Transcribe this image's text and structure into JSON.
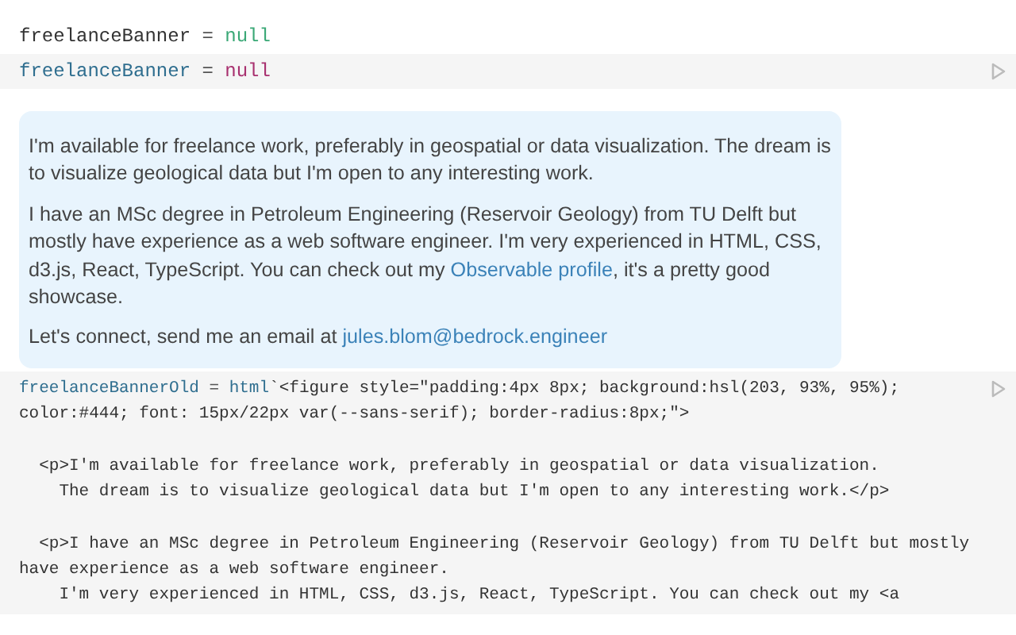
{
  "cells": [
    {
      "kind": "output",
      "tokens": [
        {
          "text": "freelanceBanner",
          "kind": "plain"
        },
        {
          "text": " = ",
          "kind": "op"
        },
        {
          "text": "null",
          "kind": "literal"
        }
      ]
    },
    {
      "kind": "code",
      "lines": [
        {
          "tokens": [
            {
              "text": "freelanceBanner",
              "kind": "variable"
            },
            {
              "text": " = ",
              "kind": "op"
            },
            {
              "text": "null",
              "kind": "null"
            }
          ]
        }
      ]
    },
    {
      "kind": "banner",
      "paragraphs": [
        [
          {
            "text": "I'm available for freelance work, preferably in geospatial or data visualization. The dream is to visualize geological data but I'm open to any interesting work.",
            "kind": "text"
          }
        ],
        [
          {
            "text": "I have an MSc degree in Petroleum Engineering (Reservoir Geology) from TU Delft but mostly have experience as a web software engineer. I'm very experienced in HTML, CSS, d3.js, React, TypeScript. You can check out my ",
            "kind": "text"
          },
          {
            "text": "Observable profile",
            "kind": "link"
          },
          {
            "text": ", it's a pretty good showcase.",
            "kind": "text"
          }
        ],
        [
          {
            "text": "Let's connect, send me an email at ",
            "kind": "text"
          },
          {
            "text": "jules.blom@bedrock.engineer",
            "kind": "link"
          }
        ]
      ]
    },
    {
      "kind": "code",
      "lines": [
        {
          "tokens": [
            {
              "text": "freelanceBannerOld",
              "kind": "variable"
            },
            {
              "text": " = ",
              "kind": "op"
            },
            {
              "text": "html",
              "kind": "keyword"
            },
            {
              "text": "`<figure style=\"padding:4px 8px; background:hsl(203, 93%, 95%);",
              "kind": "string"
            }
          ]
        },
        {
          "tokens": [
            {
              "text": "color:#444; font: 15px/22px var(--sans-serif); border-radius:8px;\">",
              "kind": "string"
            }
          ]
        },
        {
          "gap_before": true,
          "tokens": [
            {
              "text": "  <p>I'm available for freelance work, preferably in geospatial or data visualization.",
              "kind": "string"
            }
          ]
        },
        {
          "tokens": [
            {
              "text": "    The dream is to visualize geological data but I'm open to any interesting work.</p>",
              "kind": "string"
            }
          ]
        },
        {
          "gap_before": true,
          "tokens": [
            {
              "text": "  <p>I have an MSc degree in Petroleum Engineering (Reservoir Geology) from TU Delft but mostly",
              "kind": "string"
            }
          ]
        },
        {
          "tokens": [
            {
              "text": "have experience as a web software engineer.",
              "kind": "string"
            }
          ]
        },
        {
          "tokens": [
            {
              "text": "    I'm very experienced in HTML, CSS, d3.js, React, TypeScript. You can check out my <a",
              "kind": "string"
            }
          ]
        }
      ]
    }
  ]
}
